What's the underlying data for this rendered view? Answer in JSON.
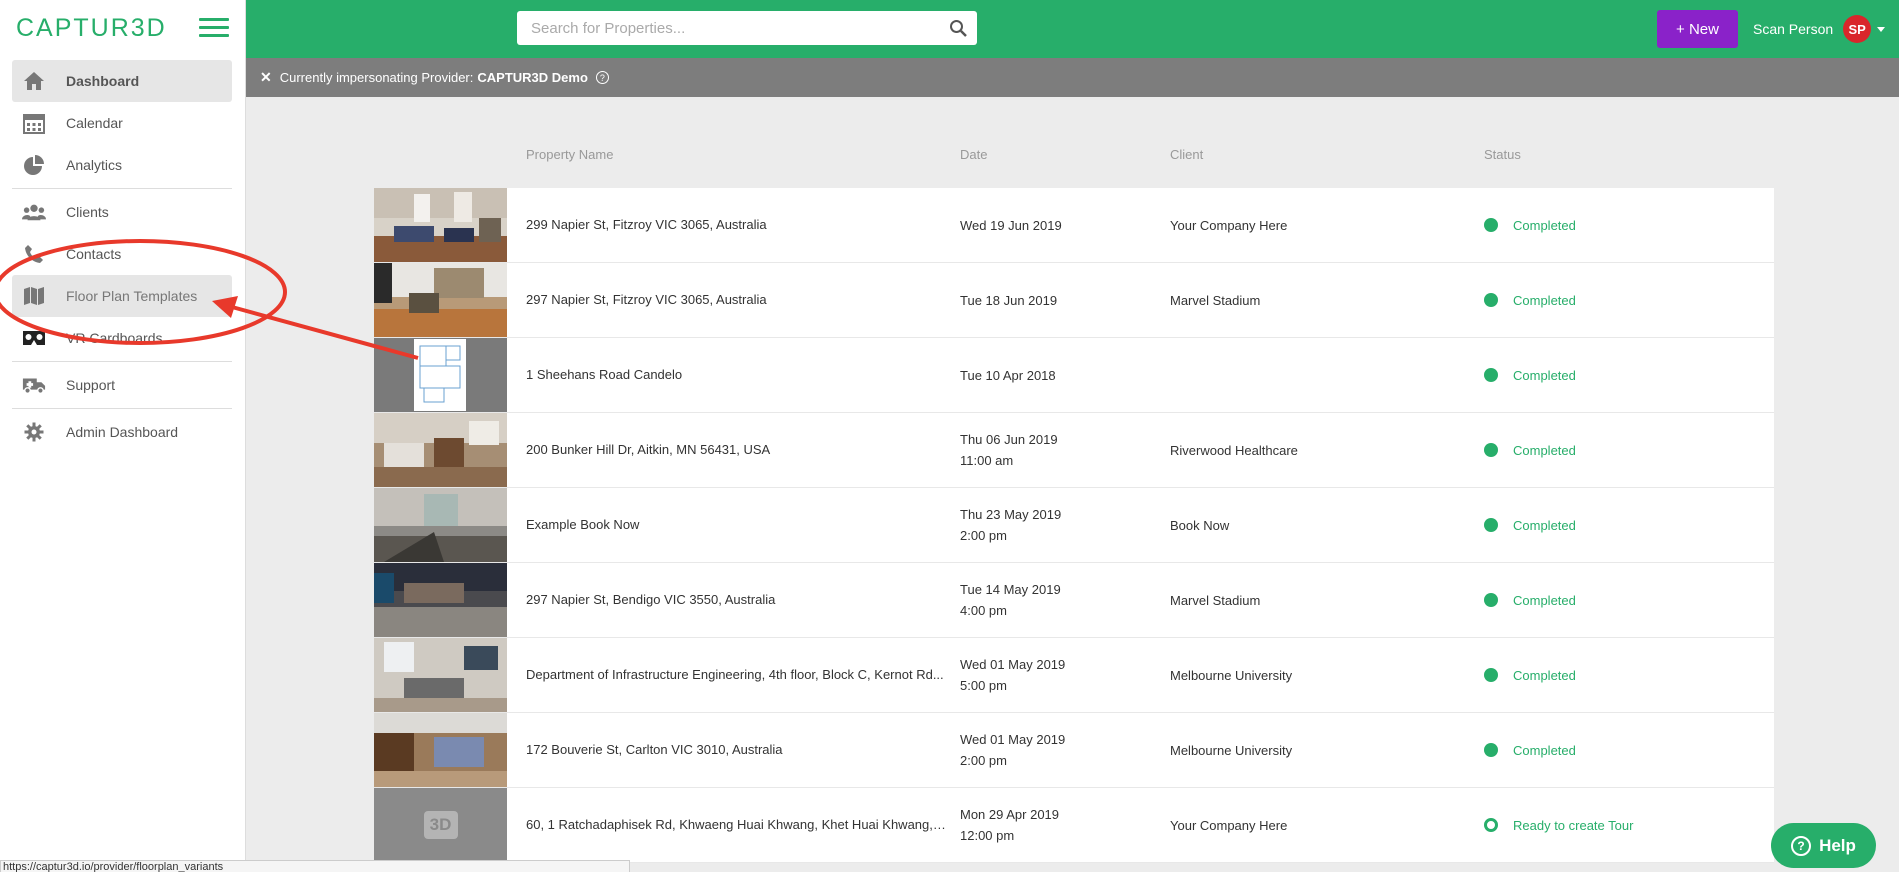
{
  "app": {
    "logo": "CAPTUR3D"
  },
  "sidebar": {
    "items": [
      {
        "label": "Dashboard",
        "icon": "home-icon"
      },
      {
        "label": "Calendar",
        "icon": "calendar-icon"
      },
      {
        "label": "Analytics",
        "icon": "pie-chart-icon"
      },
      {
        "label": "Clients",
        "icon": "users-icon"
      },
      {
        "label": "Contacts",
        "icon": "phone-icon"
      },
      {
        "label": "Floor Plan Templates",
        "icon": "map-icon"
      },
      {
        "label": "VR Cardboards",
        "icon": "vr-headset-icon"
      },
      {
        "label": "Support",
        "icon": "ambulance-icon"
      },
      {
        "label": "Admin Dashboard",
        "icon": "gear-icon"
      }
    ]
  },
  "header": {
    "search_placeholder": "Search for Properties...",
    "new_button": "+ New",
    "user_name": "Scan Person",
    "user_initials": "SP"
  },
  "impersonation": {
    "prefix": "Currently impersonating Provider:",
    "provider": "CAPTUR3D Demo"
  },
  "table": {
    "headers": {
      "name": "Property Name",
      "date": "Date",
      "client": "Client",
      "status": "Status"
    },
    "rows": [
      {
        "name": "299 Napier St, Fitzroy VIC 3065, Australia",
        "date": "Wed 19 Jun 2019",
        "time": "",
        "client": "Your Company Here",
        "status": "Completed"
      },
      {
        "name": "297 Napier St, Fitzroy VIC 3065, Australia",
        "date": "Tue 18 Jun 2019",
        "time": "",
        "client": "Marvel Stadium",
        "status": "Completed"
      },
      {
        "name": "1 Sheehans Road Candelo",
        "date": "Tue 10 Apr 2018",
        "time": "",
        "client": "",
        "status": "Completed"
      },
      {
        "name": "200 Bunker Hill Dr, Aitkin, MN 56431, USA",
        "date": "Thu 06 Jun 2019",
        "time": "11:00 am",
        "client": "Riverwood Healthcare",
        "status": "Completed"
      },
      {
        "name": "Example Book Now",
        "date": "Thu 23 May 2019",
        "time": "2:00 pm",
        "client": "Book Now",
        "status": "Completed"
      },
      {
        "name": "297 Napier St, Bendigo VIC 3550, Australia",
        "date": "Tue 14 May 2019",
        "time": "4:00 pm",
        "client": "Marvel Stadium",
        "status": "Completed"
      },
      {
        "name": "Department of Infrastructure Engineering, 4th floor, Block C, Kernot Rd...",
        "date": "Wed 01 May 2019",
        "time": "5:00 pm",
        "client": "Melbourne University",
        "status": "Completed"
      },
      {
        "name": "172 Bouverie St, Carlton VIC 3010, Australia",
        "date": "Wed 01 May 2019",
        "time": "2:00 pm",
        "client": "Melbourne University",
        "status": "Completed"
      },
      {
        "name": "60, 1 Ratchadaphisek Rd, Khwaeng Huai Khwang, Khet Huai Khwang, ...",
        "date": "Mon 29 Apr 2019",
        "time": "12:00 pm",
        "client": "Your Company Here",
        "status": "Ready to create Tour"
      }
    ]
  },
  "placeholder_thumb_label": "3D",
  "help_button": "Help",
  "status_url": "https://captur3d.io/provider/floorplan_variants",
  "colors": {
    "brand": "#27ae6a",
    "new_button": "#8a22c9",
    "avatar": "#d9262b",
    "annotation": "#e8392b"
  }
}
